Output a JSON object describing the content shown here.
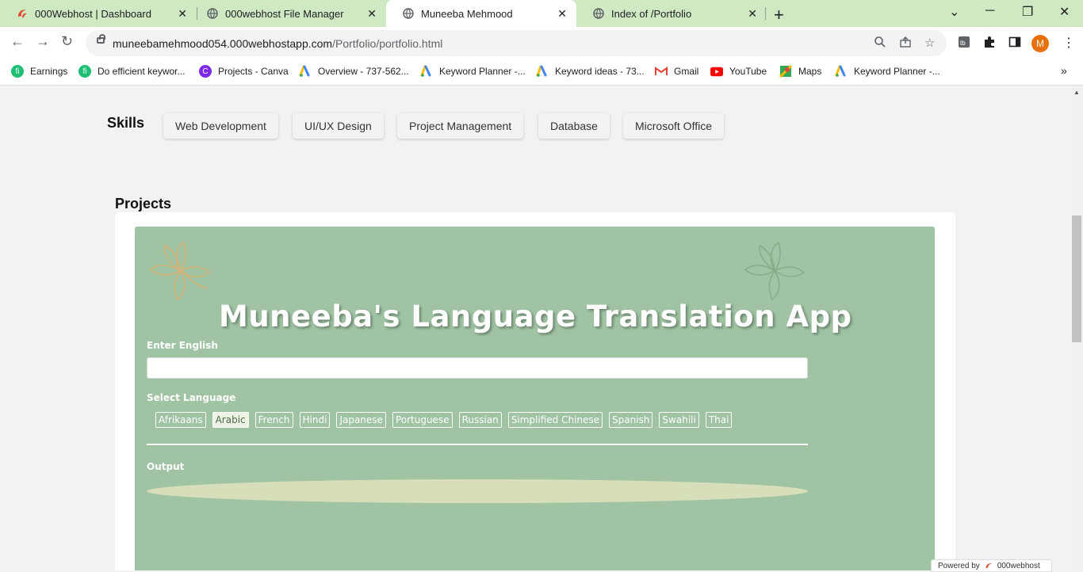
{
  "tabs": [
    {
      "title": "000Webhost | Dashboard",
      "icon": "000webhost-icon"
    },
    {
      "title": "000webhost File Manager",
      "icon": "globe-icon"
    },
    {
      "title": "Muneeba Mehmood",
      "icon": "globe-icon",
      "active": true
    },
    {
      "title": "Index of /Portfolio",
      "icon": "globe-icon"
    }
  ],
  "address": {
    "host": "muneebamehmood054.000webhostapp.com",
    "path": "/Portfolio/portfolio.html"
  },
  "profile": {
    "initial": "M"
  },
  "bookmarks": [
    {
      "label": "Earnings",
      "icon": "fiverr-icon"
    },
    {
      "label": "Do efficient keywor...",
      "icon": "fiverr-icon"
    },
    {
      "label": "Projects - Canva",
      "icon": "canva-icon"
    },
    {
      "label": "Overview - 737-562...",
      "icon": "google-ads-icon"
    },
    {
      "label": "Keyword Planner -...",
      "icon": "google-ads-icon"
    },
    {
      "label": "Keyword ideas - 73...",
      "icon": "google-ads-icon"
    },
    {
      "label": "Gmail",
      "icon": "gmail-icon"
    },
    {
      "label": "YouTube",
      "icon": "youtube-icon"
    },
    {
      "label": "Maps",
      "icon": "maps-icon"
    },
    {
      "label": "Keyword Planner -...",
      "icon": "google-ads-icon"
    }
  ],
  "skills": {
    "title": "Skills",
    "items": [
      "Web Development",
      "UI/UX Design",
      "Project Management",
      "Database",
      "Microsoft Office"
    ]
  },
  "projects": {
    "title": "Projects",
    "app": {
      "title": "Muneeba's Language Translation App",
      "input_label": "Enter English",
      "input_value": "",
      "select_label": "Select Language",
      "languages": [
        "Afrikaans",
        "Arabic",
        "French",
        "Hindi",
        "Japanese",
        "Portuguese",
        "Russian",
        "Simplified Chinese",
        "Spanish",
        "Swahili",
        "Thai"
      ],
      "selected_language": "Arabic",
      "output_label": "Output",
      "output_value": ""
    }
  },
  "footer_badge": {
    "prefix": "Powered by",
    "brand": "000webhost"
  },
  "colors": {
    "tab_strip": "#cfe9c3",
    "app_bg": "#9fc3a3",
    "output_bg": "#d6dfb9",
    "avatar": "#e8710a"
  }
}
